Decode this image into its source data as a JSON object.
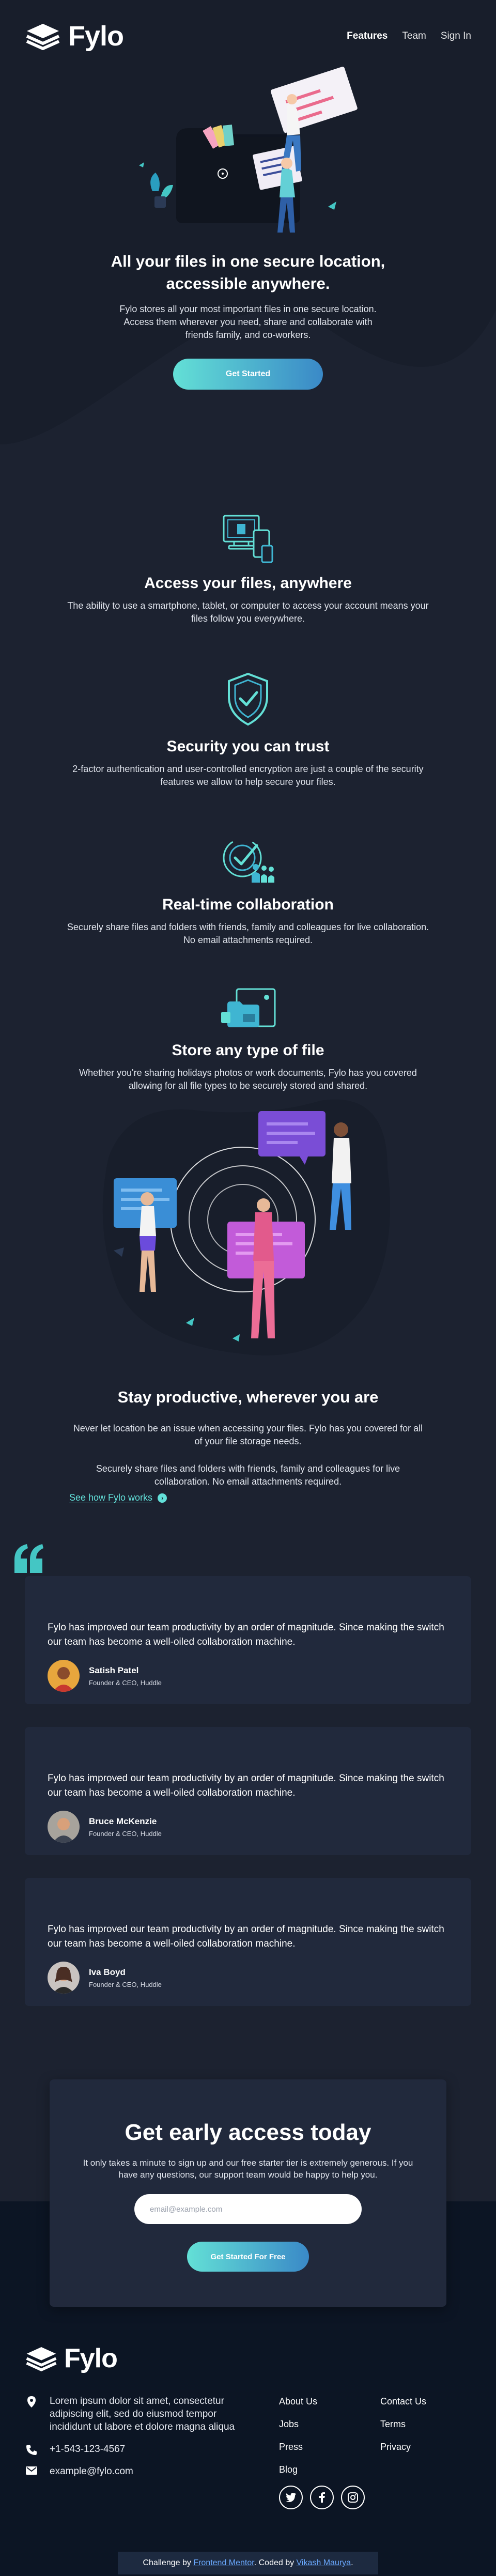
{
  "brand": {
    "name": "Fylo"
  },
  "nav": {
    "features": "Features",
    "team": "Team",
    "signin": "Sign In"
  },
  "hero": {
    "title": "All your files in one secure location, accessible anywhere.",
    "text": "Fylo stores all your most important files in one secure location. Access them wherever you need, share and collaborate with friends family, and co-workers.",
    "cta": "Get Started"
  },
  "features": [
    {
      "icon": "access-anywhere-icon",
      "title": "Access your files, anywhere",
      "text": "The ability to use a smartphone, tablet, or computer to access your account means your files follow you everywhere."
    },
    {
      "icon": "security-shield-icon",
      "title": "Security you can trust",
      "text": "2-factor authentication and user-controlled encryption are just a couple of the security features we allow to help secure your files."
    },
    {
      "icon": "collaboration-icon",
      "title": "Real-time collaboration",
      "text": "Securely share files and folders with friends, family and colleagues for live collaboration. No email attachments required."
    },
    {
      "icon": "any-file-icon",
      "title": "Store any type of file",
      "text": "Whether you're sharing holidays photos or work documents, Fylo has you covered allowing for all file types to be securely stored and shared."
    }
  ],
  "productive": {
    "title": "Stay productive, wherever you are",
    "p1": "Never let location be an issue when accessing your files. Fylo has you covered for all of your file storage needs.",
    "p2": "Securely share files and folders with friends, family and colleagues for live collaboration. No email attachments required.",
    "link": "See how Fylo works"
  },
  "testimonials": [
    {
      "quote": "Fylo has improved our team productivity by an order of magnitude. Since making the switch our team has become a well-oiled collaboration machine.",
      "name": "Satish Patel",
      "role": "Founder & CEO, Huddle"
    },
    {
      "quote": "Fylo has improved our team productivity by an order of magnitude. Since making the switch our team has become a well-oiled collaboration machine.",
      "name": "Bruce McKenzie",
      "role": "Founder & CEO, Huddle"
    },
    {
      "quote": "Fylo has improved our team productivity by an order of magnitude. Since making the switch our team has become a well-oiled collaboration machine.",
      "name": "Iva Boyd",
      "role": "Founder & CEO, Huddle"
    }
  ],
  "access": {
    "title": "Get early access today",
    "text": "It only takes a minute to sign up and our free starter tier is extremely generous. If you have any questions, our support team would be happy to help you.",
    "placeholder": "email@example.com",
    "button": "Get Started For Free"
  },
  "footer": {
    "address": "Lorem ipsum dolor sit amet, consectetur adipiscing elit, sed do eiusmod tempor incididunt ut labore et dolore magna aliqua",
    "phone": "+1-543-123-4567",
    "email": "example@fylo.com",
    "links_col1": [
      "About Us",
      "Jobs",
      "Press",
      "Blog"
    ],
    "links_col2": [
      "Contact Us",
      "Terms",
      "Privacy"
    ],
    "socials": [
      "facebook-icon",
      "twitter-icon",
      "instagram-icon"
    ]
  },
  "attribution": {
    "prefix": "Challenge by ",
    "fm": "Frontend Mentor",
    "mid": ". Coded by ",
    "author": "Vikash Maurya",
    "suffix": "."
  },
  "colors": {
    "bg": "#1c2230",
    "card": "#21293c",
    "footer": "#0c1524",
    "accent_start": "#63e0d6",
    "accent_end": "#3a89c7",
    "link": "#62e0d9"
  }
}
